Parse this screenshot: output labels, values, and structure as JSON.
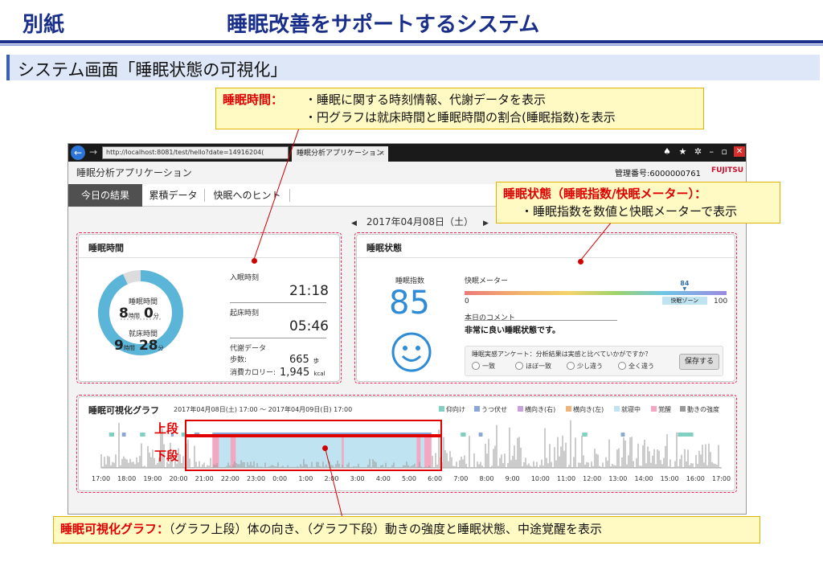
{
  "slide": {
    "left_label": "別紙",
    "title": "睡眠改善をサポートするシステム",
    "section": "システム画面「睡眠状態の可視化」"
  },
  "callouts": {
    "sleep_time": {
      "head": "睡眠時間：",
      "line1": "・睡眠に関する時刻情報、代謝データを表示",
      "line2": "・円グラフは就床時間と睡眠時間の割合(睡眠指数)を表示"
    },
    "sleep_state": {
      "head": "睡眠状態（睡眠指数/快眠メーター）：",
      "line1": "・睡眠指数を数値と快眠メーターで表示"
    },
    "graph": {
      "head": "睡眠可視化グラフ：",
      "text": "（グラフ上段）体の向き、（グラフ下段）動きの強度と睡眠状態、中途覚醒を表示"
    },
    "upper_label": "上段",
    "lower_label": "下段"
  },
  "browser": {
    "url": "http://localhost:8081/test/hello?date=14916204(",
    "tab_title": "睡眠分析アプリケーション",
    "icons": "♠ ★ ✲  –  ▫"
  },
  "app": {
    "title": "睡眠分析アプリケーション",
    "management_no": "管理番号:6000000761",
    "brand": "FUJITSU",
    "nav": [
      "今日の結果",
      "累積データ",
      "快眠へのヒント"
    ],
    "date": "2017年04月08日（土）",
    "colors": {
      "accent": "#2e8bd6",
      "ring": "#5bb5d8",
      "callout_head": "#e00000"
    }
  },
  "sleep_panel": {
    "title": "睡眠時間",
    "ring_fraction": 0.93,
    "center_top_label": "睡眠時間",
    "sleep_hours": "8",
    "sleep_minutes": "0",
    "unit_hour": "時間",
    "unit_min": "分",
    "center_bottom_label": "就床時間",
    "bed_hours": "9",
    "bed_minutes": "28",
    "bedtime_label": "入眠時刻",
    "bedtime": "21:18",
    "wake_label": "起床時刻",
    "wake": "05:46",
    "metab_label": "代謝データ",
    "steps_label": "歩数:",
    "steps": "665",
    "steps_unit": "歩",
    "cal_label": "消費カロリー:",
    "cal": "1,945",
    "cal_unit": "kcal"
  },
  "state_panel": {
    "title": "睡眠状態",
    "score_label": "睡眠指数",
    "score": "85",
    "meter_label": "快眠メーター",
    "meter_value": "84",
    "meter_zone": "快眠ゾーン",
    "meter_min": "0",
    "meter_max": "100",
    "comment_label": "本日のコメント",
    "comment": "非常に良い睡眠状態です。",
    "survey_q": "睡眠実感アンケート：分析結果は実感と比べていかがですか？",
    "options": [
      "一致",
      "ほぼ一致",
      "少し違う",
      "全く違う"
    ],
    "save": "保存する"
  },
  "graph_panel": {
    "title": "睡眠可視化グラフ",
    "range": "2017年04月08日(土) 17:00 ～ 2017年04月09日(日) 17:00",
    "legend": [
      {
        "label": "仰向け",
        "color": "#7fd0c0"
      },
      {
        "label": "うつ伏せ",
        "color": "#8aa7d8"
      },
      {
        "label": "横向き(右)",
        "color": "#c9a0dc"
      },
      {
        "label": "横向き(左)",
        "color": "#f0b37a"
      },
      {
        "label": "就寝中",
        "color": "#bfe3f0"
      },
      {
        "label": "覚醒",
        "color": "#f4a7c0"
      },
      {
        "label": "動きの強度",
        "color": "#999999"
      }
    ],
    "ticks": [
      "17:00",
      "18:00",
      "19:00",
      "20:00",
      "21:00",
      "22:00",
      "23:00",
      "0:00",
      "1:00",
      "2:00",
      "3:00",
      "4:00",
      "5:00",
      "6:00",
      "7:00",
      "8:00",
      "9:00",
      "10:00",
      "11:00",
      "12:00",
      "13:00",
      "14:00",
      "15:00",
      "16:00",
      "17:00"
    ]
  }
}
